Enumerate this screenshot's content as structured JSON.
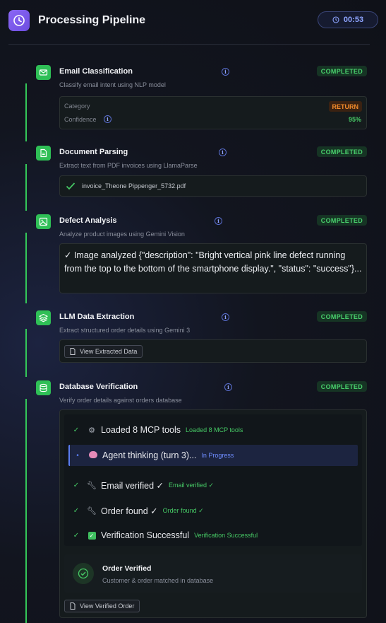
{
  "header": {
    "title": "Processing Pipeline",
    "timer": "00:53"
  },
  "steps": [
    {
      "title": "Email Classification",
      "desc": "Classify email intent using NLP model",
      "status": "COMPLETED",
      "category_label": "Category",
      "category_value": "RETURN",
      "confidence_label": "Confidence",
      "confidence_value": "95%"
    },
    {
      "title": "Document Parsing",
      "desc": "Extract text from PDF invoices using LlamaParse",
      "status": "COMPLETED",
      "file": "invoice_Theone Pippenger_5732.pdf"
    },
    {
      "title": "Defect Analysis",
      "desc": "Analyze product images using Gemini Vision",
      "status": "COMPLETED",
      "result": "✓ Image analyzed {\"description\": \"Bright vertical pink line defect running from the top to the bottom of the smartphone display.\", \"status\": \"success\"}..."
    },
    {
      "title": "LLM Data Extraction",
      "desc": "Extract structured order details using Gemini 3",
      "status": "COMPLETED",
      "button": "View Extracted Data"
    },
    {
      "title": "Database Verification",
      "desc": "Verify order details against orders database",
      "status": "COMPLETED",
      "trace": [
        {
          "check": "✓",
          "icon": "gear-icon",
          "text": "Loaded 8 MCP tools",
          "sub": "Loaded 8 MCP tools"
        },
        {
          "check": "•",
          "icon": "brain-icon",
          "text": "Agent thinking (turn 3)...",
          "sub": "In Progress"
        },
        {
          "check": "✓",
          "icon": "wrench-icon",
          "text": "Email verified ✓",
          "sub": "Email verified ✓"
        },
        {
          "check": "✓",
          "icon": "wrench-icon",
          "text": "Order found ✓",
          "sub": "Order found ✓"
        },
        {
          "check": "✓",
          "icon": "checkbox-icon",
          "text": "Verification Successful",
          "sub": "Verification Successful"
        }
      ],
      "verified_title": "Order Verified",
      "verified_desc": "Customer & order matched in database",
      "button": "View Verified Order"
    }
  ],
  "colors": {
    "accent": "#7c5cf0",
    "success": "#34c759",
    "warning": "#f08a2a",
    "info": "#6f8dff"
  }
}
